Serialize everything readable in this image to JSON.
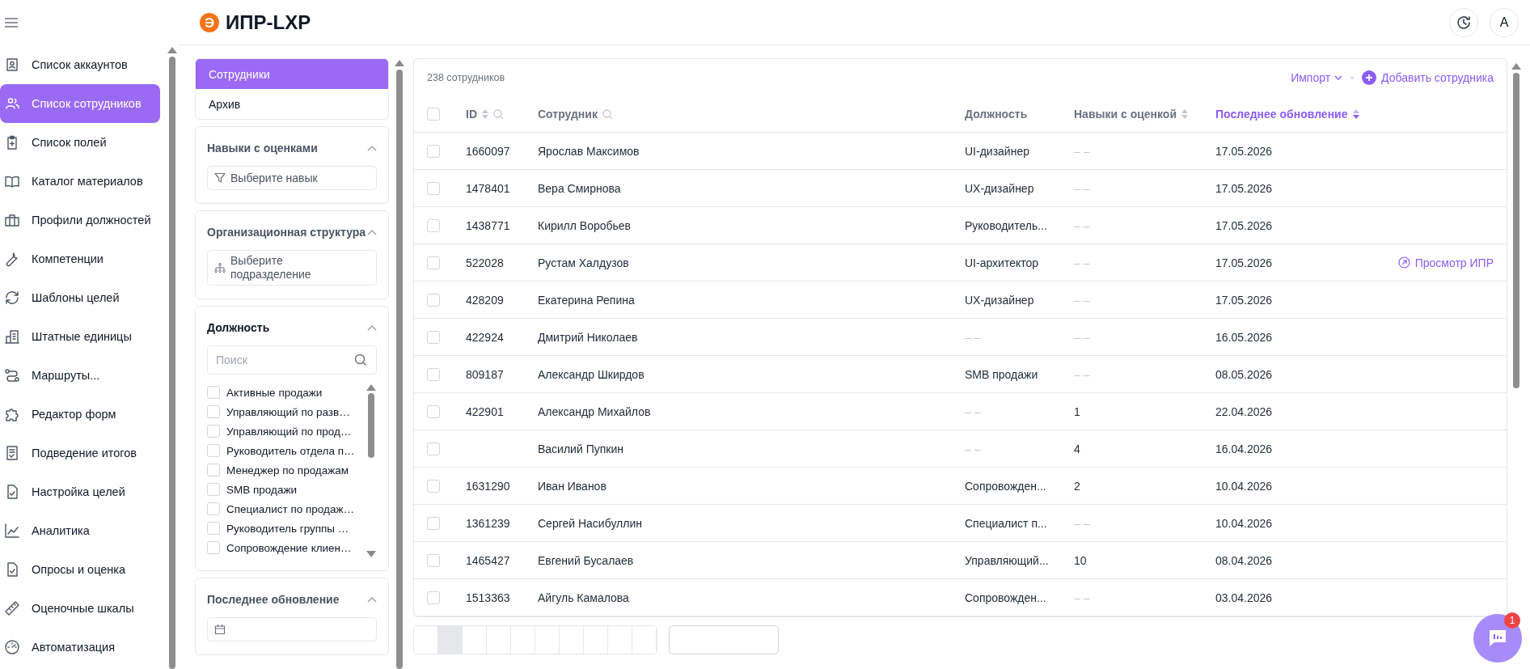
{
  "app": {
    "logo_text": "ИПР-LXP",
    "avatar_initial": "A",
    "chat_badge": "1"
  },
  "sidebar": {
    "items": [
      {
        "label": "Список аккаунтов",
        "selected": false
      },
      {
        "label": "Список сотрудников",
        "selected": true
      },
      {
        "label": "Список полей",
        "selected": false
      },
      {
        "label": "Каталог материалов",
        "selected": false
      },
      {
        "label": "Профили должностей",
        "selected": false
      },
      {
        "label": "Компетенции",
        "selected": false
      },
      {
        "label": "Шаблоны целей",
        "selected": false
      },
      {
        "label": "Штатные единицы",
        "selected": false
      },
      {
        "label": "Маршруты...",
        "selected": false
      },
      {
        "label": "Редактор форм",
        "selected": false
      },
      {
        "label": "Подведение итогов",
        "selected": false
      },
      {
        "label": "Настройка целей",
        "selected": false
      },
      {
        "label": "Аналитика",
        "selected": false
      },
      {
        "label": "Опросы и оценка",
        "selected": false
      },
      {
        "label": "Оценочные шкалы",
        "selected": false
      },
      {
        "label": "Автоматизация",
        "selected": false
      }
    ]
  },
  "views": [
    {
      "label": "Сотрудники",
      "selected": true
    },
    {
      "label": "Архив",
      "selected": false
    }
  ],
  "filters": [
    {
      "kind": "select",
      "title": "Навыки с оценками",
      "active": false,
      "expanded": true,
      "placeholder": "Выберите навык"
    },
    {
      "kind": "tree",
      "title": "Организационная структура",
      "active": false,
      "expanded": true,
      "placeholder": "Выберите подразделение"
    },
    {
      "kind": "checklist",
      "title": "Должность",
      "active": true,
      "expanded": true,
      "search_placeholder": "Поиск",
      "options": [
        {
          "label": "Активные продажи",
          "checked": false
        },
        {
          "label": "Управляющий по разв…",
          "checked": false
        },
        {
          "label": "Управляющий по прод…",
          "checked": false
        },
        {
          "label": "Руководитель отдела п…",
          "checked": false
        },
        {
          "label": "Менеджер по продажам",
          "checked": false
        },
        {
          "label": "SMB продажи",
          "checked": false
        },
        {
          "label": "Специалист по продаж…",
          "checked": false
        },
        {
          "label": "Руководитель группы …",
          "checked": false
        },
        {
          "label": "Сопровождение клиен…",
          "checked": false
        }
      ]
    },
    {
      "kind": "date",
      "title": "Последнее обновление",
      "active": false,
      "expanded": true
    }
  ],
  "table": {
    "count": "238 сотрудников",
    "import": "Импорт",
    "add": "Добавить сотрудника",
    "select_all_checked": false,
    "columns": [
      {
        "label": "ID",
        "active": false,
        "sortable": true,
        "searchable": true
      },
      {
        "label": "Сотрудник",
        "active": false,
        "searchable": true
      },
      {
        "label": "Должность",
        "active": false
      },
      {
        "label": "Навыки с оценкой",
        "active": false,
        "sortable": true
      },
      {
        "label": "Последнее обновление",
        "active": true,
        "sortable": true
      }
    ],
    "rows": [
      {
        "checked": false,
        "id": "1660097",
        "name": "Ярослав Максимов",
        "position": {
          "text": "UI-дизайнер",
          "muted": false
        },
        "skills": {
          "text": "– –",
          "muted": true
        },
        "updated": "17.05.2026"
      },
      {
        "checked": false,
        "id": "1478401",
        "name": "Вера Смирнова",
        "position": {
          "text": "UX-дизайнер",
          "muted": false
        },
        "skills": {
          "text": "– –",
          "muted": true
        },
        "updated": "17.05.2026"
      },
      {
        "checked": false,
        "id": "1438771",
        "name": "Кирилл Воробьев",
        "position": {
          "text": "Руководитель...",
          "muted": false
        },
        "skills": {
          "text": "– –",
          "muted": true
        },
        "updated": "17.05.2026"
      },
      {
        "checked": false,
        "id": "522028",
        "name": "Рустам Халдузов",
        "position": {
          "text": "UI-архитектор",
          "muted": false
        },
        "skills": {
          "text": "– –",
          "muted": true
        },
        "updated": "17.05.2026",
        "action": "Просмотр ИПР"
      },
      {
        "checked": false,
        "id": "428209",
        "name": "Екатерина Репина",
        "position": {
          "text": "UX-дизайнер",
          "muted": false
        },
        "skills": {
          "text": "– –",
          "muted": true
        },
        "updated": "17.05.2026"
      },
      {
        "checked": false,
        "id": "422924",
        "name": "Дмитрий Николаев",
        "position": {
          "text": "– –",
          "muted": true
        },
        "skills": {
          "text": "– –",
          "muted": true
        },
        "updated": "16.05.2026"
      },
      {
        "checked": false,
        "id": "809187",
        "name": "Александр Шкирдов",
        "position": {
          "text": "SMB продажи",
          "muted": false
        },
        "skills": {
          "text": "– –",
          "muted": true
        },
        "updated": "08.05.2026"
      },
      {
        "checked": false,
        "id": "422901",
        "name": "Александр Михайлов",
        "position": {
          "text": "– –",
          "muted": true
        },
        "skills": {
          "text": "1",
          "muted": false
        },
        "updated": "22.04.2026"
      },
      {
        "checked": false,
        "name": "Василий Пупкин",
        "position": {
          "text": "– –",
          "muted": true
        },
        "skills": {
          "text": "4",
          "muted": false
        },
        "updated": "16.04.2026"
      },
      {
        "checked": false,
        "id": "1631290",
        "name": "Иван Иванов",
        "position": {
          "text": "Сопровожден...",
          "muted": false
        },
        "skills": {
          "text": "2",
          "muted": false
        },
        "updated": "10.04.2026"
      },
      {
        "checked": false,
        "id": "1361239",
        "name": "Сергей Насибуллин",
        "position": {
          "text": "Специалист п...",
          "muted": false
        },
        "skills": {
          "text": "– –",
          "muted": true
        },
        "updated": "10.04.2026"
      },
      {
        "checked": false,
        "id": "1465427",
        "name": "Евгений Бусалаев",
        "position": {
          "text": "Управляющий...",
          "muted": false
        },
        "skills": {
          "text": "10",
          "muted": false
        },
        "updated": "08.04.2026"
      },
      {
        "checked": false,
        "id": "1513363",
        "name": "Айгуль Камалова",
        "position": {
          "text": "Сопровожден...",
          "muted": false
        },
        "skills": {
          "text": "– –",
          "muted": true
        },
        "updated": "03.04.2026"
      }
    ]
  },
  "pagination": {
    "pages": [
      {
        "selected": false
      },
      {
        "selected": true
      },
      {
        "selected": false
      },
      {
        "selected": false
      },
      {
        "selected": false
      },
      {
        "selected": false
      },
      {
        "selected": false
      },
      {
        "selected": false
      },
      {
        "selected": false
      },
      {
        "selected": false
      }
    ]
  }
}
